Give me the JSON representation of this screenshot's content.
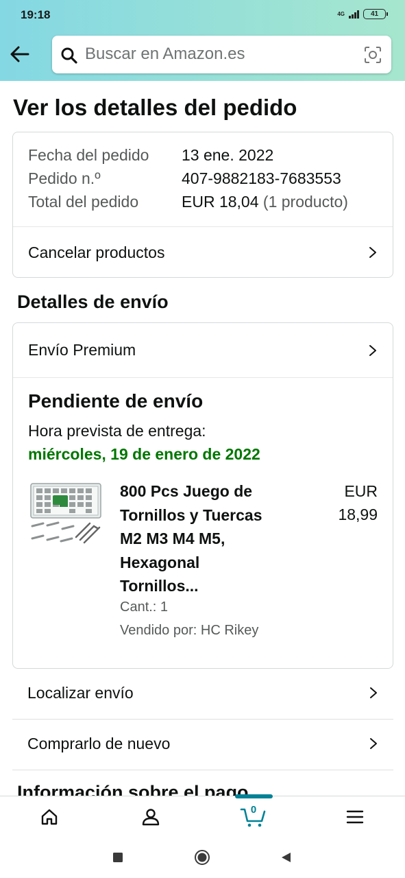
{
  "status_bar": {
    "time": "19:18",
    "network": "4G",
    "battery": "41"
  },
  "search": {
    "placeholder": "Buscar en Amazon.es"
  },
  "page": {
    "title": "Ver los detalles del pedido"
  },
  "order_summary": {
    "date_label": "Fecha del pedido",
    "date_value": "13 ene. 2022",
    "number_label": "Pedido n.º",
    "number_value": "407-9882183-7683553",
    "total_label": "Total del pedido",
    "total_value": "EUR 18,04",
    "total_count": "(1 producto)",
    "cancel_label": "Cancelar productos"
  },
  "shipping": {
    "section_title": "Detalles de envío",
    "method": "Envío Premium",
    "status": "Pendiente de envío",
    "eta_label": "Hora prevista de entrega:",
    "eta_date": "miércoles, 19 de enero de 2022",
    "product": {
      "title_lines": [
        "800 Pcs Juego de",
        "Tornillos y Tuercas",
        "M2 M3 M4 M5,",
        "Hexagonal",
        "Tornillos..."
      ],
      "price_currency": "EUR",
      "price_value": "18,99",
      "quantity": "Cant.: 1",
      "seller": "Vendido por: HC Rikey"
    }
  },
  "actions": {
    "track": "Localizar envío",
    "buy_again": "Comprarlo de nuevo"
  },
  "payment": {
    "section_title": "Información sobre el pago"
  },
  "bottom_nav": {
    "cart_count": "0"
  },
  "colors": {
    "accent": "#008296",
    "delivery_green": "#007600",
    "header_start": "#84d8e3",
    "header_end": "#a6e6ce"
  }
}
